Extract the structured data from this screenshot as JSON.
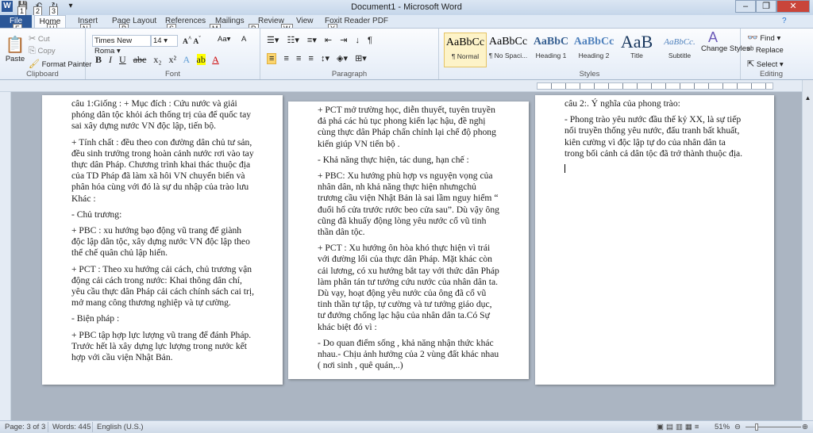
{
  "window": {
    "title": "Document1 - Microsoft Word"
  },
  "qat": {
    "keytips": [
      "1",
      "2",
      "3"
    ]
  },
  "tabs": [
    {
      "label": "File",
      "keytip": "F"
    },
    {
      "label": "Home",
      "keytip": "H"
    },
    {
      "label": "Insert",
      "keytip": "N"
    },
    {
      "label": "Page Layout",
      "keytip": "P"
    },
    {
      "label": "References",
      "keytip": "S"
    },
    {
      "label": "Mailings",
      "keytip": "M"
    },
    {
      "label": "Review",
      "keytip": "R"
    },
    {
      "label": "View",
      "keytip": "W"
    },
    {
      "label": "Foxit Reader PDF",
      "keytip": "Y"
    }
  ],
  "clipboard": {
    "paste": "Paste",
    "cut": "Cut",
    "copy": "Copy",
    "format_painter": "Format Painter",
    "label": "Clipboard"
  },
  "font": {
    "name": "Times New Roma",
    "size": "14",
    "label": "Font"
  },
  "paragraph": {
    "label": "Paragraph"
  },
  "styles": {
    "items": [
      {
        "preview": "AaBbCc",
        "name": "¶ Normal",
        "color": "#000000"
      },
      {
        "preview": "AaBbCc",
        "name": "¶ No Spaci...",
        "color": "#000000"
      },
      {
        "preview": "AaBbC",
        "name": "Heading 1",
        "color": "#365f91"
      },
      {
        "preview": "AaBbCc",
        "name": "Heading 2",
        "color": "#4f81bd"
      },
      {
        "preview": "AaB",
        "name": "Title",
        "color": "#17365d"
      },
      {
        "preview": "AaBbCc.",
        "name": "Subtitle",
        "color": "#4f81bd"
      }
    ],
    "change_styles": "Change Styles",
    "label": "Styles"
  },
  "editing": {
    "find": "Find",
    "replace": "Replace",
    "select": "Select",
    "label": "Editing"
  },
  "pages": [
    {
      "paragraphs": [
        "câu 1:Giống : + Mục đích : Cứu nước và giải phóng dân tộc khỏi ách thống trị của để quốc tay sai xây dựng nước VN độc lập, tiến bộ.",
        "+ Tính chất : đều theo con đường dân chủ tư sản, đều sinh trưởng trong hoàn cảnh nước rơi vào tay thực dân Pháp. Chương trình khai thác thuộc địa của TD Pháp đã làm xã hôi VN chuyển biến và phân hóa cùng với đó là sự du nhập của trào lưu Khác :",
        "- Chủ trương:",
        "+ PBC : xu hướng bạo động vũ trang để giành độc lập dân tộc, xây dựng nước VN độc lập theo thể chế quân chủ lập hiến.",
        "+ PCT : Theo xu hướng cải cách, chủ trương vận động cải cách trong nước: Khai thông dân chí, yêu cầu thực dân Pháp cải cách chính sách cai trị, mở mang công thương nghiệp và tự cường.",
        "- Biện pháp :",
        "+ PBC tập hợp lực lượng vũ trang để đánh Pháp. Trước hết là xây dựng lực lượng trong nước kết hợp với cầu viện Nhật Bản."
      ]
    },
    {
      "paragraphs": [
        "+ PCT mở trường học, diễn thuyết, tuyên truyền đả phá các hủ tục phong kiến lạc hậu, đề nghị cùng thực dân Pháp chấn chỉnh lại chế độ phong kiến giúp VN tiến bộ .",
        "- Khả năng thực hiện, tác dung, hạn chế :",
        "+ PBC: Xu hướng phù hợp vs nguyện vọng của nhân dân, nh khả năng thực hiện nhưngchủ trương cầu viện Nhật Bản là sai lầm nguy hiểm “ đuổi hổ cửa trước rước beo cửa sau”. Dù vậy ông cũng đã khuấy động lòng yêu nước cổ vũ tinh thần dân tộc.",
        "+ PCT : Xu hướng ôn hòa khó thực hiện vì trái với đường lối của thực dân Pháp. Mặt khác còn cải lương, có xu hướng bắt tay với thức dân Pháp làm phân tán tư tưởng cứu nước của nhân dân ta. Dù vạy, hoạt động yêu nước của ông đã cổ vũ tinh thần tự tập, tự cường và tư tưởng giáo dục, tư đưởng chống lạc hậu của nhân dân ta.Có Sự khác biệt đó vì :",
        "- Do quan điểm sống , khả năng nhận thức khác nhau.- Chịu ảnh hưởng của 2 vùng đất khác nhau ( nơi sinh , quê quán,..)"
      ]
    },
    {
      "paragraphs": [
        "câu 2:. Ý nghĩa của phong trào:",
        "- Phong trào yêu nước đầu thế kỷ XX, là sự tiếp nối truyền thống yêu nước, đấu tranh bất khuất, kiên cường vì độc lập tự do của nhân dân ta trong bối cảnh cả dân tộc đã trở thành thuộc địa."
      ]
    }
  ],
  "status": {
    "page": "Page: 3 of 3",
    "words": "Words: 445",
    "language": "English (U.S.)",
    "zoom": "51%",
    "zoom_percent": 51
  }
}
